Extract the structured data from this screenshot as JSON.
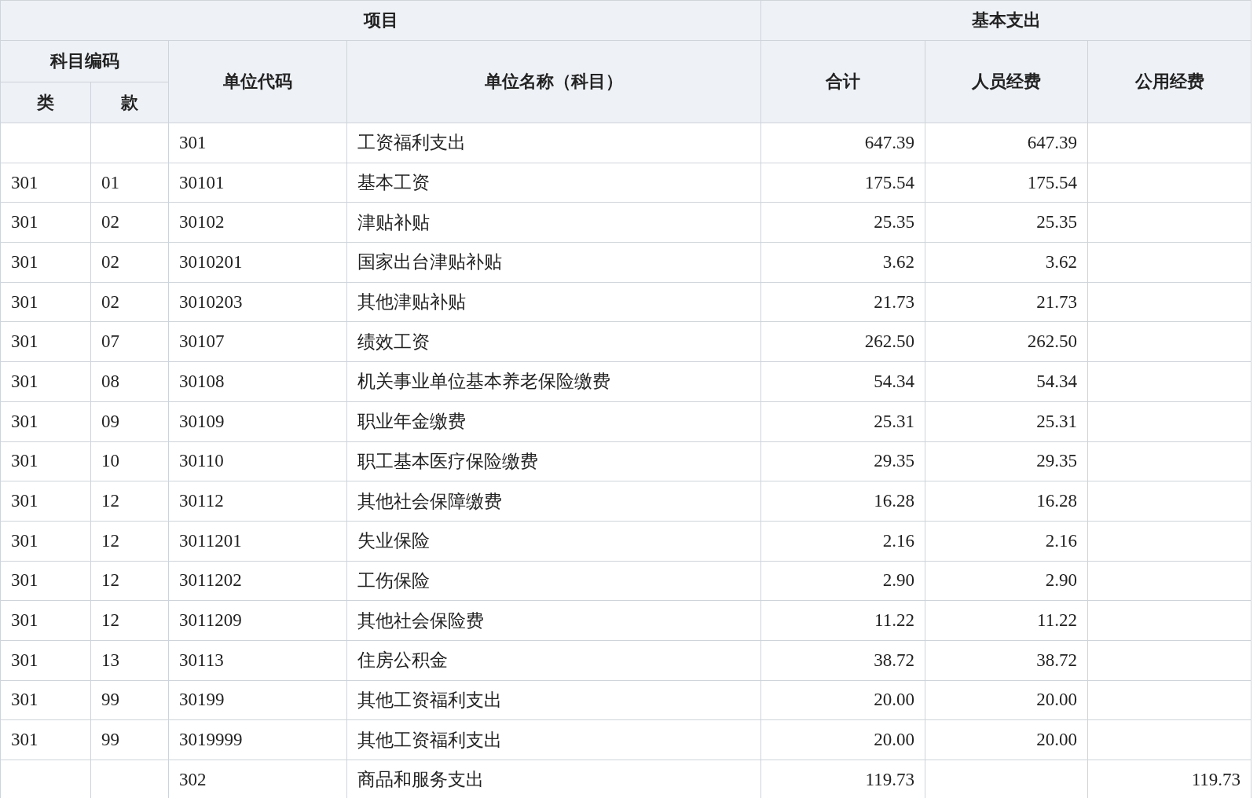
{
  "header": {
    "project": "项目",
    "basic_expenditure": "基本支出",
    "subject_code": "科目编码",
    "class": "类",
    "item": "款",
    "unit_code": "单位代码",
    "unit_name": "单位名称（科目）",
    "total": "合计",
    "personnel": "人员经费",
    "public": "公用经费"
  },
  "rows": [
    {
      "code": "301",
      "name": "工资福利支出",
      "total": "647.39",
      "personnel": "647.39"
    },
    {
      "class": "301",
      "item": "01",
      "code": "30101",
      "name": "基本工资",
      "total": "175.54",
      "personnel": "175.54"
    },
    {
      "class": "301",
      "item": "02",
      "code": "30102",
      "name": "津贴补贴",
      "total": "25.35",
      "personnel": "25.35"
    },
    {
      "class": "301",
      "item": "02",
      "code": "3010201",
      "name": "国家出台津贴补贴",
      "total": "3.62",
      "personnel": "3.62"
    },
    {
      "class": "301",
      "item": "02",
      "code": "3010203",
      "name": "其他津贴补贴",
      "total": "21.73",
      "personnel": "21.73"
    },
    {
      "class": "301",
      "item": "07",
      "code": "30107",
      "name": "绩效工资",
      "total": "262.50",
      "personnel": "262.50"
    },
    {
      "class": "301",
      "item": "08",
      "code": "30108",
      "name": "机关事业单位基本养老保险缴费",
      "total": "54.34",
      "personnel": "54.34"
    },
    {
      "class": "301",
      "item": "09",
      "code": "30109",
      "name": "职业年金缴费",
      "total": "25.31",
      "personnel": "25.31"
    },
    {
      "class": "301",
      "item": "10",
      "code": "30110",
      "name": "职工基本医疗保险缴费",
      "total": "29.35",
      "personnel": "29.35"
    },
    {
      "class": "301",
      "item": "12",
      "code": "30112",
      "name": "其他社会保障缴费",
      "total": "16.28",
      "personnel": "16.28"
    },
    {
      "class": "301",
      "item": "12",
      "code": "3011201",
      "name": "失业保险",
      "total": "2.16",
      "personnel": "2.16"
    },
    {
      "class": "301",
      "item": "12",
      "code": "3011202",
      "name": "工伤保险",
      "total": "2.90",
      "personnel": "2.90"
    },
    {
      "class": "301",
      "item": "12",
      "code": "3011209",
      "name": "其他社会保险费",
      "total": "11.22",
      "personnel": "11.22"
    },
    {
      "class": "301",
      "item": "13",
      "code": "30113",
      "name": "住房公积金",
      "total": "38.72",
      "personnel": "38.72"
    },
    {
      "class": "301",
      "item": "99",
      "code": "30199",
      "name": "其他工资福利支出",
      "total": "20.00",
      "personnel": "20.00"
    },
    {
      "class": "301",
      "item": "99",
      "code": "3019999",
      "name": "其他工资福利支出",
      "total": "20.00",
      "personnel": "20.00"
    },
    {
      "code": "302",
      "name": "商品和服务支出",
      "total": "119.73",
      "public": "119.73"
    }
  ]
}
